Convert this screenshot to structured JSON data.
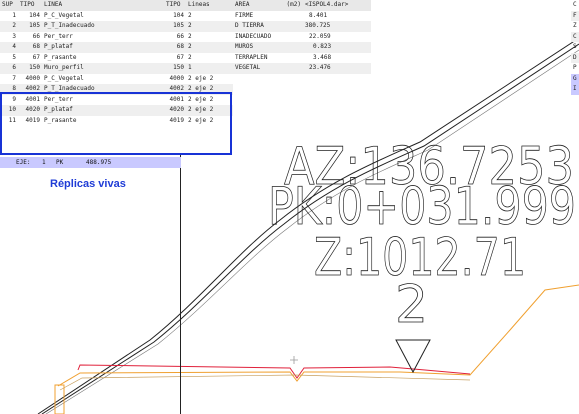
{
  "line_table": {
    "headers": [
      "SUP",
      "TIPO",
      "LINEA",
      "TIPO",
      "Lineas"
    ],
    "rows": [
      {
        "sup": "1",
        "tipo": "104",
        "linea": "P_C_Vegetal",
        "tipo2": "104",
        "lineas": "2"
      },
      {
        "sup": "2",
        "tipo": "105",
        "linea": "P_T_Inadecuado",
        "tipo2": "105",
        "lineas": "2"
      },
      {
        "sup": "3",
        "tipo": "66",
        "linea": "Per_terr",
        "tipo2": "66",
        "lineas": "2"
      },
      {
        "sup": "4",
        "tipo": "68",
        "linea": "P_plataf",
        "tipo2": "68",
        "lineas": "2"
      },
      {
        "sup": "5",
        "tipo": "67",
        "linea": "P_rasante",
        "tipo2": "67",
        "lineas": "2"
      },
      {
        "sup": "6",
        "tipo": "150",
        "linea": "Muro_perfil",
        "tipo2": "150",
        "lineas": "1"
      },
      {
        "sup": "7",
        "tipo": "4000",
        "linea": "P_C_Vegetal",
        "tipo2": "4000",
        "lineas": "2 eje 2"
      },
      {
        "sup": "8",
        "tipo": "4002",
        "linea": "P_T_Inadecuado",
        "tipo2": "4002",
        "lineas": "2 eje 2"
      },
      {
        "sup": "9",
        "tipo": "4001",
        "linea": "Per_terr",
        "tipo2": "4001",
        "lineas": "2 eje 2"
      },
      {
        "sup": "10",
        "tipo": "4020",
        "linea": "P_plataf",
        "tipo2": "4020",
        "lineas": "2 eje 2"
      },
      {
        "sup": "11",
        "tipo": "4019",
        "linea": "P_rasante",
        "tipo2": "4019",
        "lineas": "2 eje 2"
      }
    ]
  },
  "area_table": {
    "header_area": "AREA",
    "header_unit": "(m2)",
    "header_file": "<ISPOL4.dar>",
    "rows": [
      {
        "name": "FIRME",
        "value": "8.401"
      },
      {
        "name": "D TIERRA",
        "value": "380.725"
      },
      {
        "name": "INADECUADO",
        "value": "22.059"
      },
      {
        "name": "MUROS",
        "value": "0.823"
      },
      {
        "name": "TERRAPLEN",
        "value": "3.468"
      },
      {
        "name": "VEGETAL",
        "value": "23.476"
      }
    ]
  },
  "right_strip": [
    "C",
    "F",
    "Z",
    "C",
    "S",
    "D",
    "P",
    "G",
    "I"
  ],
  "eje_bar": {
    "label": "EJE:",
    "eje": "1",
    "pk_label": "PK",
    "pk_value": "488.975"
  },
  "replicas_label": "Réplicas vivas",
  "annotations": {
    "az": "AZ:136.7253",
    "pk": "PK:0+031.999",
    "z": "Z:1012.71",
    "num": "2"
  },
  "colors": {
    "replica_border": "#1833d6",
    "eje_bar_bg": "#c9c9ff",
    "replica_text": "#1f3cd6",
    "alignment_lines": "#222222",
    "red_profile": "#e0203a",
    "orange_profile": "#f0a030"
  }
}
